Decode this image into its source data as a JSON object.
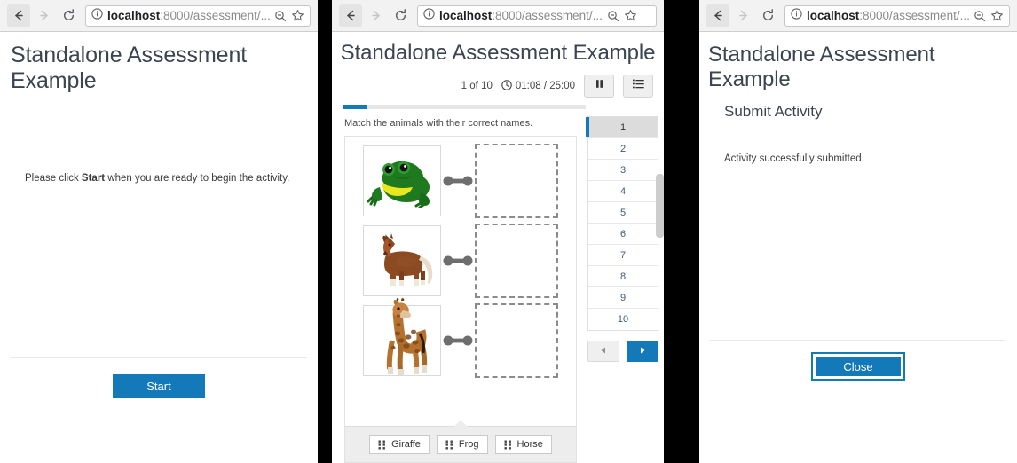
{
  "browser": {
    "back_icon": "arrow-left-icon",
    "forward_icon": "arrow-right-icon",
    "reload_icon": "reload-icon",
    "info_icon": "info-circle-icon",
    "url_host": "localhost",
    "url_rest": ":8000/assessment/...",
    "zoom_icon": "zoom-out-icon",
    "bookmark_icon": "star-icon"
  },
  "panel1": {
    "title": "Standalone Assessment Example",
    "instruction_before": "Please click ",
    "instruction_bold": "Start",
    "instruction_after": " when you are ready to begin the activity.",
    "start_label": "Start"
  },
  "panel2": {
    "title": "Standalone Assessment Example",
    "counter": "1 of 10",
    "clock_icon": "clock-icon",
    "time": "01:08 / 25:00",
    "pause_icon": "pause-icon",
    "outline_icon": "list-outline-icon",
    "progress_percent": 10,
    "question_text": "Match the animals with their correct names.",
    "matches": [
      {
        "animal": "frog",
        "label": "Frog"
      },
      {
        "animal": "horse",
        "label": "Horse"
      },
      {
        "animal": "giraffe",
        "label": "Giraffe"
      }
    ],
    "tokens": [
      {
        "label": "Giraffe",
        "grip_icon": "drag-handle-icon"
      },
      {
        "label": "Frog",
        "grip_icon": "drag-handle-icon"
      },
      {
        "label": "Horse",
        "grip_icon": "drag-handle-icon"
      }
    ],
    "nav_items": [
      "1",
      "2",
      "3",
      "4",
      "5",
      "6",
      "7",
      "8",
      "9",
      "10"
    ],
    "active_nav_index": 0,
    "prev_icon": "triangle-left-icon",
    "next_icon": "triangle-right-icon",
    "accent_color": "#1479b8"
  },
  "panel3": {
    "title": "Standalone Assessment Example",
    "subtitle": "Submit Activity",
    "message": "Activity successfully submitted.",
    "close_label": "Close"
  }
}
